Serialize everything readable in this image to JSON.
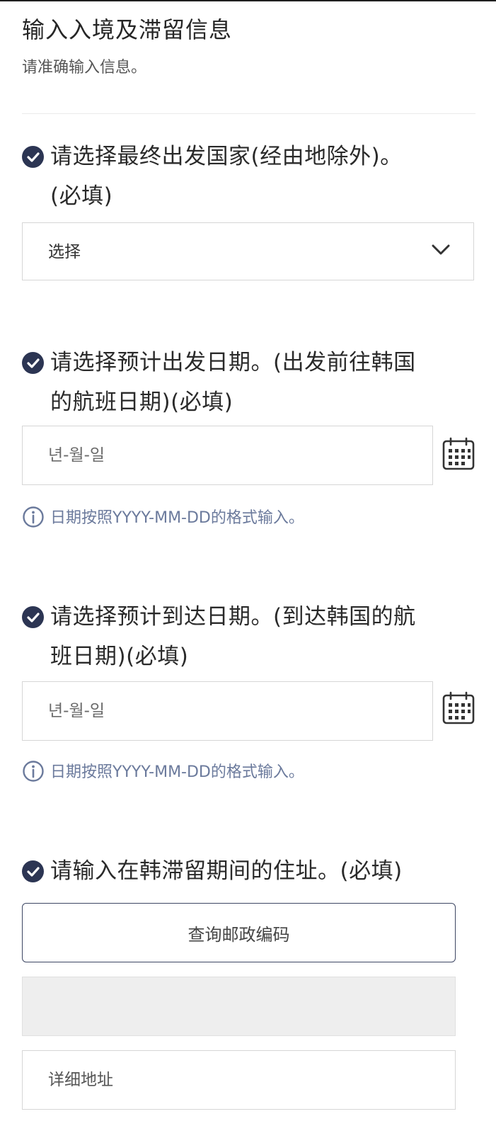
{
  "header": {
    "title": "输入入境及滞留信息",
    "subtitle": "请准确输入信息。"
  },
  "departure_country": {
    "label_line1": "请选择最终出发国家(经由地除外)。",
    "label_line2": "(必填)",
    "selected": "选择",
    "check_icon": "check-circle-icon",
    "chevron_icon": "chevron-down-icon"
  },
  "departure_date": {
    "label_line1": "请选择预计出发日期。(出发前往韩国",
    "label_line2": "的航班日期)(必填)",
    "placeholder": "년-월-일",
    "hint": "日期按照YYYY-MM-DD的格式输入。",
    "calendar_icon": "calendar-icon",
    "info_icon": "info-icon"
  },
  "arrival_date": {
    "label_line1": "请选择预计到达日期。(到达韩国的航",
    "label_line2": "班日期)(必填)",
    "placeholder": "년-월-일",
    "hint": "日期按照YYYY-MM-DD的格式输入。",
    "calendar_icon": "calendar-icon",
    "info_icon": "info-icon"
  },
  "address": {
    "label": "请输入在韩滞留期间的住址。(必填)",
    "zip_button_label": "查询邮政编码",
    "detail_placeholder": "详细地址"
  },
  "colors": {
    "accent": "#2c3553",
    "hint": "#6b7a9c",
    "border": "#d6d6d6",
    "readonly_bg": "#eeeeee"
  }
}
